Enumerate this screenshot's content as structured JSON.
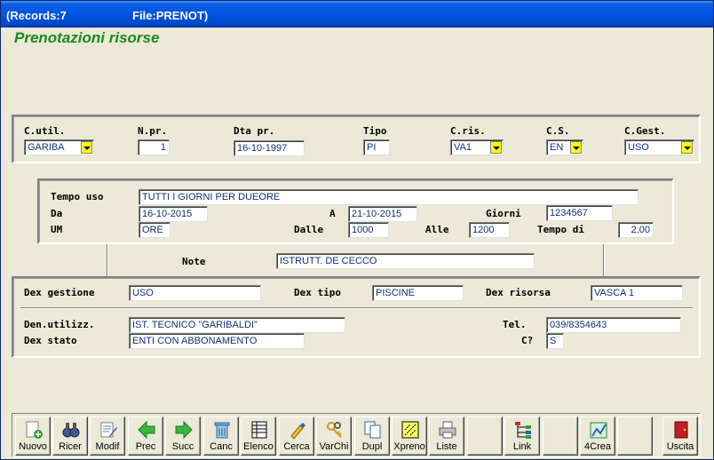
{
  "window": {
    "records": "(Records:7",
    "file": "File:PRENOT)"
  },
  "form_title": "Prenotazioni risorse",
  "top_panel": {
    "c_util": {
      "label": "C.util.",
      "value": "GARIBA"
    },
    "n_pr": {
      "label": "N.pr.",
      "value": "1"
    },
    "dta_pr": {
      "label": "Dta pr.",
      "value": "16-10-1997"
    },
    "tipo": {
      "label": "Tipo",
      "value": "PI"
    },
    "c_ris": {
      "label": "C.ris.",
      "value": "VA1"
    },
    "c_s": {
      "label": "C.S.",
      "value": "EN"
    },
    "c_gest": {
      "label": "C.Gest.",
      "value": "USO"
    }
  },
  "middle_panel": {
    "tempo_uso": {
      "label": "Tempo uso",
      "value": "TUTTI I GIORNI PER DUEORE"
    },
    "da": {
      "label": "Da",
      "value": "16-10-2015"
    },
    "a": {
      "label": "A",
      "value": "21-10-2015"
    },
    "giorni": {
      "label": "Giorni",
      "value": "1234567"
    },
    "um": {
      "label": "UM",
      "value": "ORE"
    },
    "dalle": {
      "label": "Dalle",
      "value": "1000"
    },
    "alle": {
      "label": "Alle",
      "value": "1200"
    },
    "tempo_di": {
      "label": "Tempo di",
      "value": "2.00"
    }
  },
  "note": {
    "label": "Note",
    "value": "ISTRUTT. DE CECCO"
  },
  "bottom_panel": {
    "dex_gestione": {
      "label": "Dex gestione",
      "value": "USO"
    },
    "dex_tipo": {
      "label": "Dex tipo",
      "value": "PISCINE"
    },
    "dex_risorsa": {
      "label": "Dex risorsa",
      "value": "VASCA 1"
    },
    "den_utilizz": {
      "label": "Den.utilizz.",
      "value": "IST. TECNICO \"GARIBALDI\""
    },
    "tel": {
      "label": "Tel.",
      "value": "039/8354643"
    },
    "dex_stato": {
      "label": "Dex stato",
      "value": "ENTI CON ABBONAMENTO"
    },
    "c_q": {
      "label": "C?",
      "value": "S"
    }
  },
  "toolbar": {
    "nuovo": "Nuovo",
    "ricer": "Ricer",
    "modif": "Modif",
    "prec": "Prec",
    "succ": "Succ",
    "canc": "Canc",
    "elenco": "Elenco",
    "cerca": "Cerca",
    "varchi": "VarChi",
    "dupl": "Dupl",
    "xpreno": "Xpreno",
    "liste": "Liste",
    "link": "Link",
    "crea4": "4Crea",
    "uscita": "Uscita"
  },
  "colors": {
    "title_green": "#1a8a1a",
    "field_text": "#10307a",
    "dropdown_yellow": "#ffff00",
    "titlebar_blue": "#0054e3"
  }
}
